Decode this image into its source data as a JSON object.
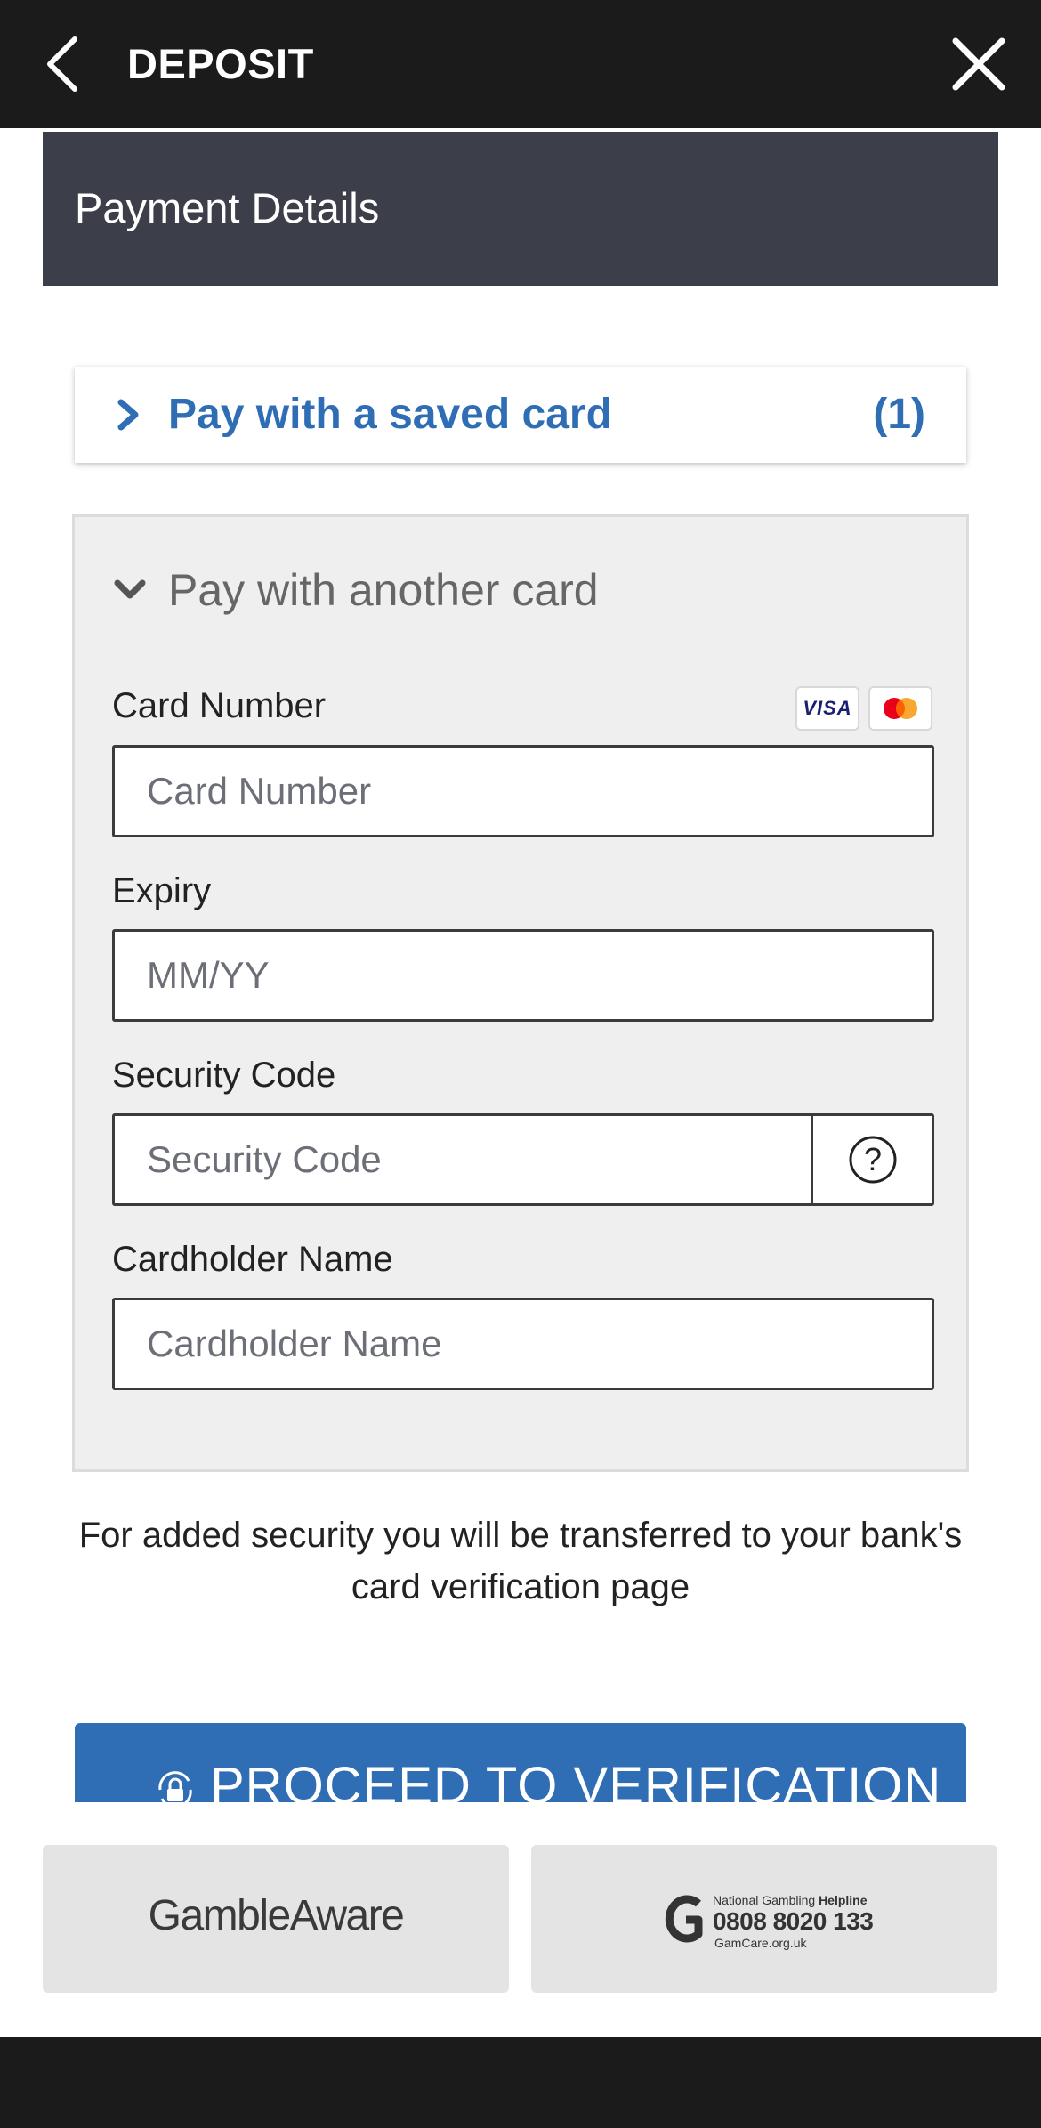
{
  "header": {
    "title": "DEPOSIT",
    "back_icon": "chevron-left-icon",
    "close_icon": "close-icon"
  },
  "payment_details": {
    "heading": "Payment Details"
  },
  "saved_card": {
    "label": "Pay with a saved card",
    "count": "(1)",
    "icon": "chevron-right-icon"
  },
  "another_card": {
    "label": "Pay with another card",
    "icon": "chevron-down-icon",
    "card_brands": [
      "VISA",
      "Mastercard"
    ],
    "fields": {
      "card_number": {
        "label": "Card Number",
        "placeholder": "Card Number",
        "value": ""
      },
      "expiry": {
        "label": "Expiry",
        "placeholder": "MM/YY",
        "value": ""
      },
      "security_code": {
        "label": "Security Code",
        "placeholder": "Security Code",
        "value": "",
        "help_icon": "question-circle-icon"
      },
      "cardholder_name": {
        "label": "Cardholder Name",
        "placeholder": "Cardholder Name",
        "value": ""
      }
    }
  },
  "security_note": "For added security you will be transferred to your bank's card verification page",
  "proceed_button": {
    "label": "PROCEED TO VERIFICATION",
    "icon": "lock-refresh-icon"
  },
  "footer": {
    "gamble_aware": "GambleAware",
    "helpline": {
      "title_prefix": "National Gambling ",
      "title_bold": "Helpline",
      "number": "0808 8020 133",
      "url": "GamCare.org.uk"
    }
  },
  "colors": {
    "topbar": "#1b1b1b",
    "panel_header": "#3c3f4a",
    "accent_blue": "#2f6db5",
    "card_bg": "#efefef",
    "footer_btn": "#e4e4e4"
  }
}
